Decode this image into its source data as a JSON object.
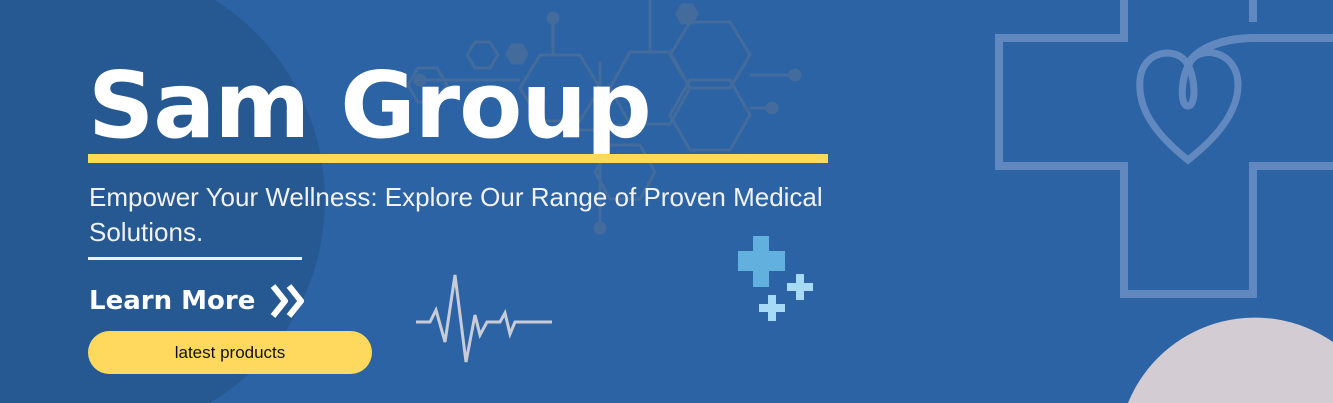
{
  "banner": {
    "title": "Sam Group",
    "subtitle": "Empower Your Wellness: Explore Our Range of Proven Medical Solutions.",
    "learn_more_label": "Learn More",
    "cta_label": "latest products"
  },
  "colors": {
    "background": "#2b63a4",
    "accent_yellow": "#ffd95e",
    "cross_outline": "#6189c0",
    "plus_blue": "#62b0dd",
    "plus_light": "#a7dbf5",
    "grey_circle": "#d3cdd3"
  }
}
